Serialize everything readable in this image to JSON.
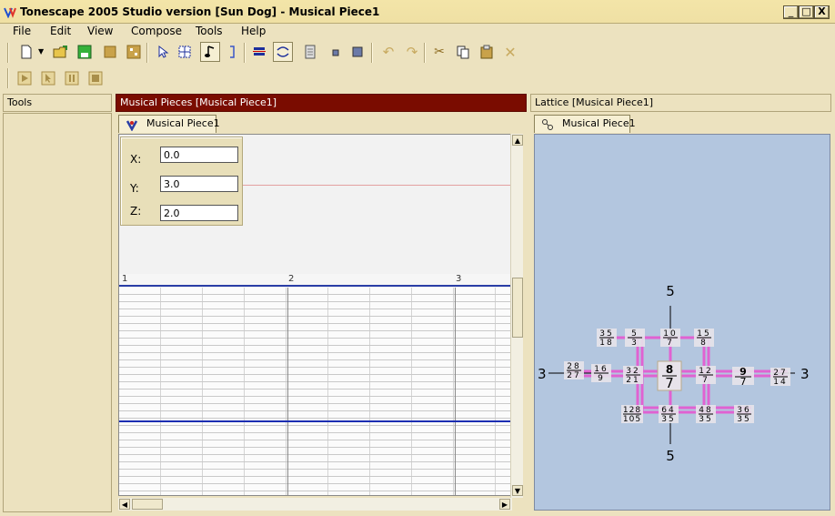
{
  "window": {
    "title": "Tonescape 2005 Studio  version [Sun Dog]  -  Musical Piece1",
    "controls": [
      "_",
      "□",
      "X"
    ]
  },
  "menu": [
    "File",
    "Edit",
    "View",
    "Compose",
    "Tools",
    "Help"
  ],
  "toolbar": {
    "row1_icons": [
      "new-document-icon",
      "dropdown-arrow-icon",
      "open-folder-icon",
      "save-disk-icon",
      "box-icon",
      "properties-icon",
      "select-arrow-icon",
      "grid-select-icon",
      "note-icon",
      "bracket-icon",
      "align-icon",
      "loop-icon",
      "page-icon",
      "small-square-icon",
      "square-icon",
      "undo-icon",
      "redo-icon",
      "cut-icon",
      "copy-icon",
      "paste-icon",
      "delete-icon"
    ],
    "row2_icons": [
      "play-icon",
      "pointer-play-icon",
      "pause-icon",
      "stop-icon"
    ]
  },
  "panes": {
    "tools": {
      "header": "Tools"
    },
    "music": {
      "header": "Musical Pieces  [Musical Piece1]",
      "tab": "Musical Piece1",
      "coords": {
        "x_label": "X:",
        "x_value": "0.0",
        "y_label": "Y:",
        "y_value": "3.0",
        "z_label": "Z:",
        "z_value": "2.0"
      },
      "ruler": [
        "1",
        "2",
        "3"
      ]
    },
    "lattice": {
      "header": "Lattice  [Musical Piece1]",
      "tab": "Musical Piece1",
      "axis_labels": {
        "top": "5",
        "bottom": "5",
        "left": "3",
        "right": "3"
      },
      "nodes": [
        {
          "n": "35",
          "d": "18"
        },
        {
          "n": "5",
          "d": "3"
        },
        {
          "n": "10",
          "d": "7"
        },
        {
          "n": "15",
          "d": "8"
        },
        {
          "n": "28",
          "d": "27"
        },
        {
          "n": "16",
          "d": "9"
        },
        {
          "n": "32",
          "d": "21"
        },
        {
          "n": "8",
          "d": "7"
        },
        {
          "n": "12",
          "d": "7"
        },
        {
          "n": "9",
          "d": "7"
        },
        {
          "n": "27",
          "d": "14"
        },
        {
          "n": "128",
          "d": "105"
        },
        {
          "n": "64",
          "d": "35"
        },
        {
          "n": "48",
          "d": "35"
        },
        {
          "n": "36",
          "d": "35"
        }
      ]
    }
  },
  "colors": {
    "chrome": "#ece2bf",
    "music_header": "#7a0c00",
    "lattice_bg": "#b3c6df",
    "lattice_link": "#e062d2",
    "note_line": "#1c2eb2"
  }
}
